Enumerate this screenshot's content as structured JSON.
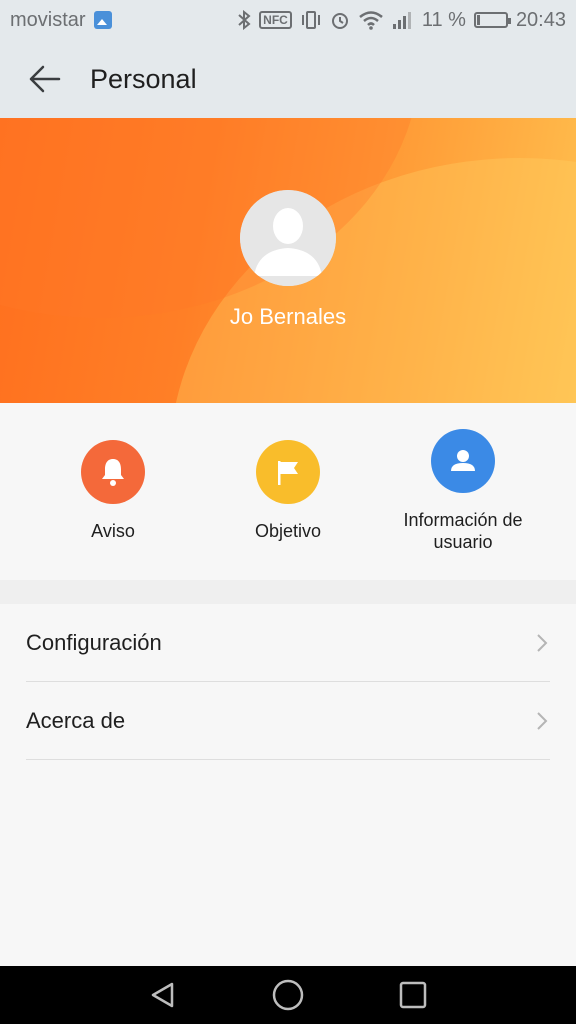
{
  "status_bar": {
    "carrier": "movistar",
    "battery_percent": "11 %",
    "battery_level": 0.11,
    "time": "20:43"
  },
  "app_bar": {
    "title": "Personal"
  },
  "profile": {
    "name": "Jo Bernales"
  },
  "quick_actions": [
    {
      "label": "Aviso",
      "icon": "bell-icon",
      "color": "#f4693a"
    },
    {
      "label": "Objetivo",
      "icon": "flag-icon",
      "color": "#f9bd2b"
    },
    {
      "label": "Información de usuario",
      "icon": "user-card-icon",
      "color": "#3b8ae6"
    }
  ],
  "menu": [
    {
      "label": "Configuración"
    },
    {
      "label": "Acerca de"
    }
  ],
  "colors": {
    "header_start": "#ff6f1e",
    "header_end": "#ffc04f"
  }
}
